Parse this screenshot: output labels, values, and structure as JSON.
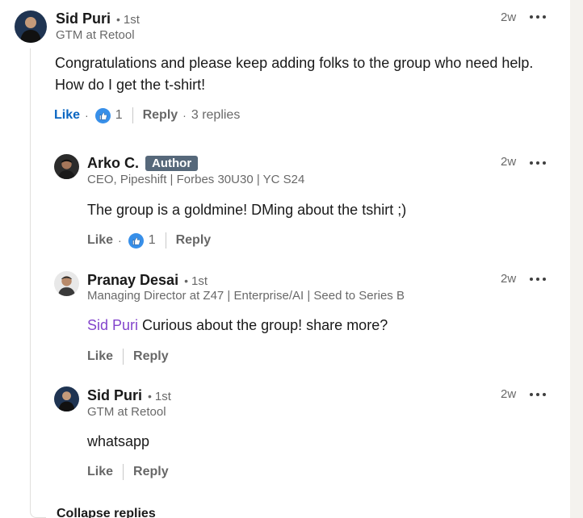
{
  "comment": {
    "author": "Sid Puri",
    "degree": "1st",
    "headline": "GTM at Retool",
    "time": "2w",
    "text_line1": "Congratulations and please keep adding folks to the group who need help.",
    "text_line2": "How do I get the t-shirt!",
    "like_label": "Like",
    "reaction_count": "1",
    "reply_label": "Reply",
    "replies_label": "3 replies"
  },
  "replies": [
    {
      "author": "Arko C.",
      "badge": "Author",
      "headline": "CEO, Pipeshift | Forbes 30U30 | YC S24",
      "time": "2w",
      "text": "The group is a goldmine! DMing about the tshirt ;)",
      "like_label": "Like",
      "reaction_count": "1",
      "reply_label": "Reply"
    },
    {
      "author": "Pranay Desai",
      "degree": "1st",
      "headline": "Managing Director at Z47 | Enterprise/AI | Seed to Series B",
      "time": "2w",
      "mention": "Sid Puri",
      "text": " Curious about the group! share more?",
      "like_label": "Like",
      "reply_label": "Reply"
    },
    {
      "author": "Sid Puri",
      "degree": "1st",
      "headline": "GTM at Retool",
      "time": "2w",
      "text": "whatsapp",
      "like_label": "Like",
      "reply_label": "Reply"
    }
  ],
  "collapse_label": "Collapse replies",
  "icons": {
    "more": "more-options-icon",
    "reaction": "like-reaction-icon"
  },
  "colors": {
    "link_blue": "#0a66c2",
    "reaction_blue": "#378fe9",
    "mention_purple": "#8344cc",
    "badge_gray": "#56687a"
  }
}
